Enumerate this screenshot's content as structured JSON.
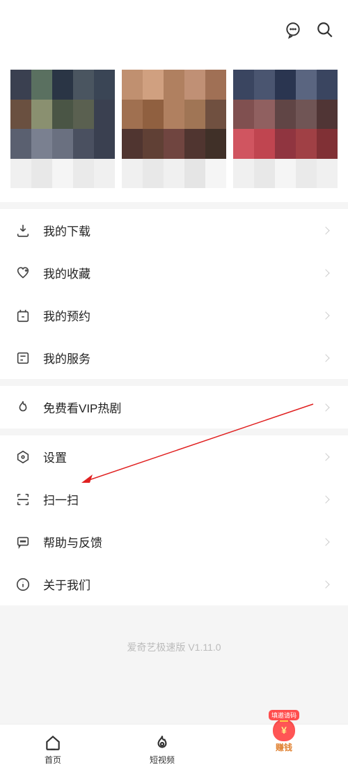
{
  "header": {},
  "menu": {
    "group1": [
      {
        "icon": "download",
        "label": "我的下载"
      },
      {
        "icon": "heart",
        "label": "我的收藏"
      },
      {
        "icon": "calendar",
        "label": "我的预约"
      },
      {
        "icon": "list",
        "label": "我的服务"
      }
    ],
    "group2": [
      {
        "icon": "fire",
        "label": "免费看VIP热剧"
      }
    ],
    "group3": [
      {
        "icon": "hex",
        "label": "设置"
      },
      {
        "icon": "scan",
        "label": "扫一扫"
      },
      {
        "icon": "feedback",
        "label": "帮助与反馈"
      },
      {
        "icon": "info",
        "label": "关于我们"
      }
    ]
  },
  "version": "爱奇艺极速版 V1.11.0",
  "nav": {
    "home": "首页",
    "short": "短视频",
    "money_tag": "填邀请码",
    "money_label": "赚钱"
  }
}
